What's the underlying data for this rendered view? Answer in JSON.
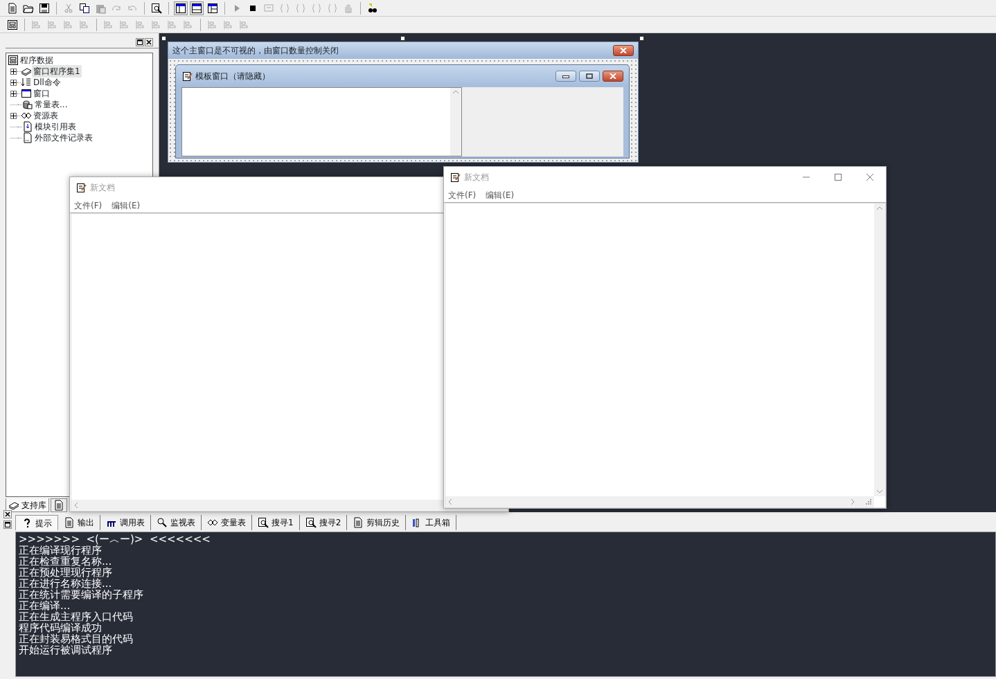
{
  "left_panel": {
    "tree": {
      "label": "程序数据",
      "children": [
        {
          "label": "窗口程序集1",
          "expandable": true,
          "selected": true
        },
        {
          "label": "Dll命令",
          "expandable": true,
          "selected": false
        },
        {
          "label": "窗口",
          "expandable": true,
          "selected": false
        },
        {
          "label": "常量表...",
          "expandable": false,
          "selected": false
        },
        {
          "label": "资源表",
          "expandable": true,
          "selected": false
        },
        {
          "label": "模块引用表",
          "expandable": false,
          "selected": false
        },
        {
          "label": "外部文件记录表",
          "expandable": false,
          "selected": false
        }
      ]
    },
    "tabs": [
      {
        "label": "支持库",
        "selected": true
      },
      {
        "selected": false
      }
    ]
  },
  "designer": {
    "main_title": "这个主窗口是不可视的，由窗口数量控制关闭",
    "template_title": "模板窗口（请隐藏）"
  },
  "windows": [
    {
      "title": "新文档",
      "menus": [
        "文件(F)",
        "编辑(E)"
      ]
    },
    {
      "title": "新文档",
      "menus": [
        "文件(F)",
        "编辑(E)"
      ]
    }
  ],
  "bottom_tabs": [
    {
      "label": "提示",
      "selected": true
    },
    {
      "label": "输出",
      "selected": false
    },
    {
      "label": "调用表",
      "selected": false
    },
    {
      "label": "监视表",
      "selected": false
    },
    {
      "label": "变量表",
      "selected": false
    },
    {
      "label": "搜寻1",
      "selected": false
    },
    {
      "label": "搜寻2",
      "selected": false
    },
    {
      "label": "剪辑历史",
      "selected": false
    },
    {
      "label": "工具箱",
      "selected": false
    }
  ],
  "output_lines": [
    ">>>>>>>  <(ー︿ー)>  <<<<<<<",
    "正在编译现行程序",
    "正在检查重复名称...",
    "正在预处理现行程序",
    "正在进行名称连接...",
    "正在统计需要编译的子程序",
    "正在编译...",
    "正在生成主程序入口代码",
    "程序代码编译成功",
    "正在封装易格式目的代码",
    "开始运行被调试程序"
  ]
}
